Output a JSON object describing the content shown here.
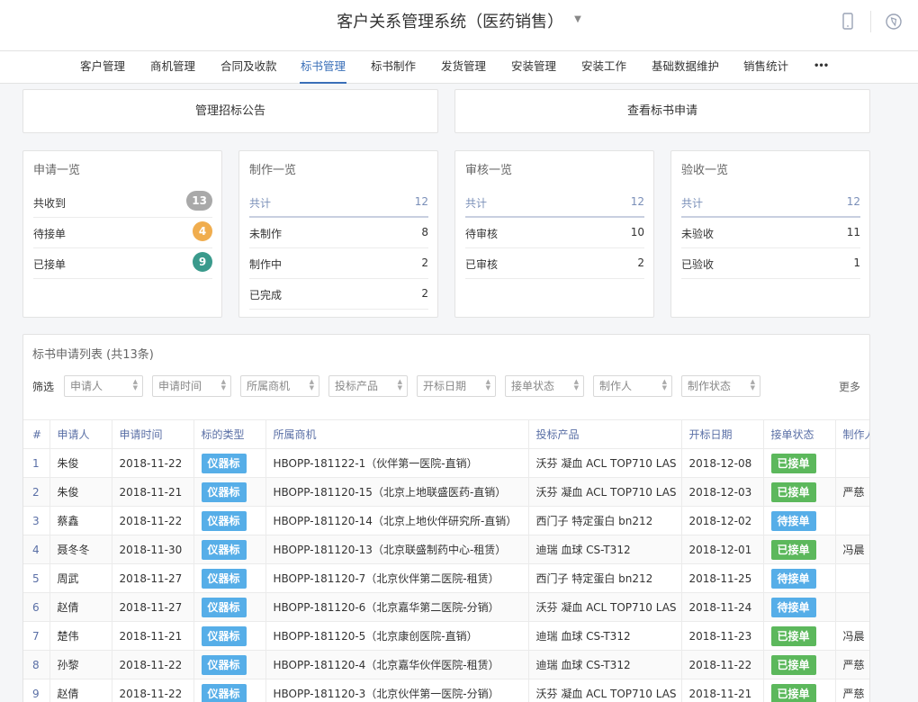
{
  "app": {
    "title": "客户关系管理系统（医药销售）"
  },
  "nav": {
    "items": [
      "客户管理",
      "商机管理",
      "合同及收款",
      "标书管理",
      "标书制作",
      "发货管理",
      "安装管理",
      "安装工作",
      "基础数据维护",
      "销售统计"
    ],
    "more": "•••"
  },
  "actions": {
    "manage_tender": "管理招标公告",
    "view_apply": "查看标书申请"
  },
  "cards": {
    "apply": {
      "title": "申请一览",
      "rows": [
        {
          "label": "共收到",
          "value": "13",
          "color": "#a9a9a9"
        },
        {
          "label": "待接单",
          "value": "4",
          "color": "#f0ad4e"
        },
        {
          "label": "已接单",
          "value": "9",
          "color": "#3a9a8c"
        }
      ]
    },
    "make": {
      "title": "制作一览",
      "total_label": "共计",
      "total": "12",
      "rows": [
        {
          "label": "未制作",
          "value": "8"
        },
        {
          "label": "制作中",
          "value": "2"
        },
        {
          "label": "已完成",
          "value": "2"
        }
      ]
    },
    "review": {
      "title": "审核一览",
      "total_label": "共计",
      "total": "12",
      "rows": [
        {
          "label": "待审核",
          "value": "10"
        },
        {
          "label": "已审核",
          "value": "2"
        }
      ]
    },
    "accept": {
      "title": "验收一览",
      "total_label": "共计",
      "total": "12",
      "rows": [
        {
          "label": "未验收",
          "value": "11"
        },
        {
          "label": "已验收",
          "value": "1"
        }
      ]
    }
  },
  "list": {
    "title": "标书申请列表 (共13条)",
    "filter_label": "筛选",
    "filters": [
      "申请人",
      "申请时间",
      "所属商机",
      "投标产品",
      "开标日期",
      "接单状态",
      "制作人",
      "制作状态"
    ],
    "more": "更多",
    "columns": [
      "#",
      "申请人",
      "申请时间",
      "标的类型",
      "所属商机",
      "投标产品",
      "开标日期",
      "接单状态",
      "制作人"
    ],
    "rows": [
      [
        "1",
        "朱俊",
        "2018-11-22",
        "仪器标",
        "HBOPP-181122-1（伙伴第一医院-直销）",
        "沃芬 凝血 ACL TOP710 LAS",
        "2018-12-08",
        "已接单",
        ""
      ],
      [
        "2",
        "朱俊",
        "2018-11-21",
        "仪器标",
        "HBOPP-181120-15（北京上地联盛医药-直销）",
        "沃芬 凝血 ACL TOP710 LAS",
        "2018-12-03",
        "已接单",
        "严慈"
      ],
      [
        "3",
        "蔡鑫",
        "2018-11-22",
        "仪器标",
        "HBOPP-181120-14（北京上地伙伴研究所-直销）",
        "西门子 特定蛋白 bn212",
        "2018-12-02",
        "待接单",
        ""
      ],
      [
        "4",
        "聂冬冬",
        "2018-11-30",
        "仪器标",
        "HBOPP-181120-13（北京联盛制药中心-租赁）",
        "迪瑞 血球 CS-T312",
        "2018-12-01",
        "已接单",
        "冯晨"
      ],
      [
        "5",
        "周武",
        "2018-11-27",
        "仪器标",
        "HBOPP-181120-7（北京伙伴第二医院-租赁）",
        "西门子 特定蛋白 bn212",
        "2018-11-25",
        "待接单",
        ""
      ],
      [
        "6",
        "赵倩",
        "2018-11-27",
        "仪器标",
        "HBOPP-181120-6（北京嘉华第二医院-分销）",
        "沃芬 凝血 ACL TOP710 LAS",
        "2018-11-24",
        "待接单",
        ""
      ],
      [
        "7",
        "楚伟",
        "2018-11-21",
        "仪器标",
        "HBOPP-181120-5（北京康创医院-直销）",
        "迪瑞 血球 CS-T312",
        "2018-11-23",
        "已接单",
        "冯晨"
      ],
      [
        "8",
        "孙黎",
        "2018-11-22",
        "仪器标",
        "HBOPP-181120-4（北京嘉华伙伴医院-租赁）",
        "迪瑞 血球 CS-T312",
        "2018-11-22",
        "已接单",
        "严慈"
      ],
      [
        "9",
        "赵倩",
        "2018-11-22",
        "仪器标",
        "HBOPP-181120-3（北京伙伴第一医院-分销）",
        "沃芬 凝血 ACL TOP710 LAS",
        "2018-11-21",
        "已接单",
        "严慈"
      ]
    ]
  }
}
